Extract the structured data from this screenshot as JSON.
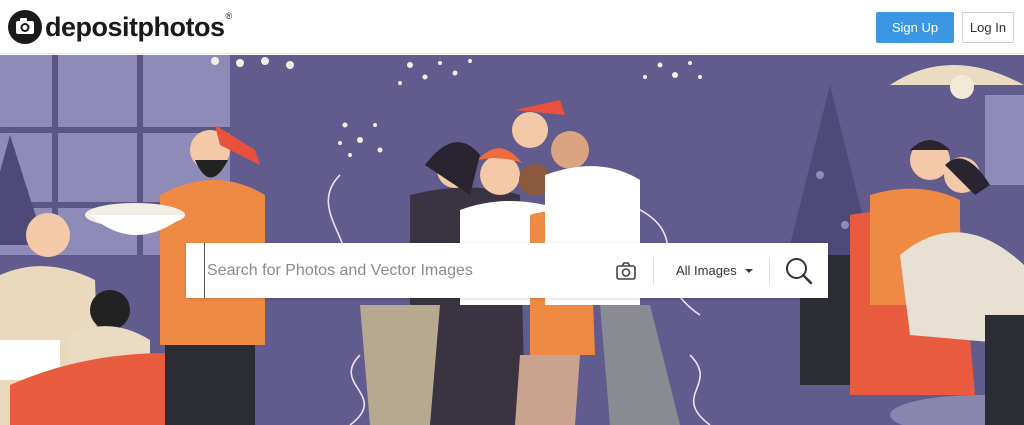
{
  "header": {
    "logo_text": "depositphotos",
    "logo_reg": "®",
    "signup_label": "Sign Up",
    "login_label": "Log In"
  },
  "search": {
    "placeholder": "Search for Photos and Vector Images",
    "value": "",
    "type_selected": "All Images"
  },
  "icons": {
    "logo": "camera-logo-icon",
    "camera": "camera-icon",
    "search": "search-icon",
    "dropdown": "caret-down-icon"
  },
  "colors": {
    "accent": "#3b97e3",
    "hero_background": "#615b8e"
  }
}
